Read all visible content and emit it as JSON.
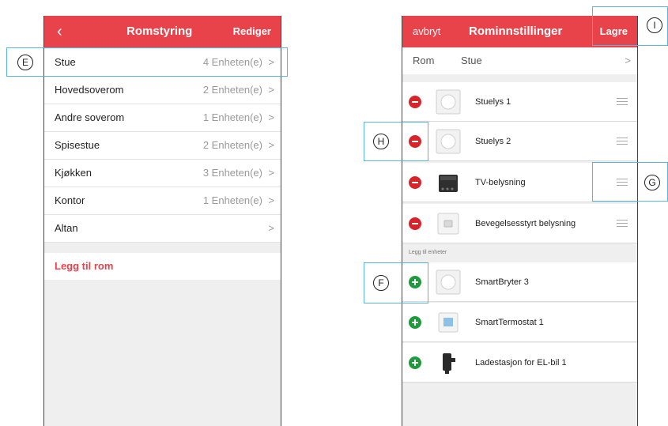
{
  "left_screen": {
    "back_icon": "‹",
    "title": "Romstyring",
    "edit_label": "Rediger",
    "rooms": [
      {
        "name": "Stue",
        "count": "4 Enheten(e)"
      },
      {
        "name": "Hovedsoverom",
        "count": "2 Enheten(e)"
      },
      {
        "name": "Andre soverom",
        "count": "1 Enheten(e)"
      },
      {
        "name": "Spisestue",
        "count": "2 Enheten(e)"
      },
      {
        "name": "Kjøkken",
        "count": "3 Enheten(e)"
      },
      {
        "name": "Kontor",
        "count": "1 Enheten(e)"
      },
      {
        "name": "Altan",
        "count": ""
      }
    ],
    "add_room_label": "Legg til rom",
    "accent_color": "#e8424a"
  },
  "right_screen": {
    "cancel_label": "avbryt",
    "title": "Rominnstillinger",
    "save_label": "Lagre",
    "room_label": "Rom",
    "room_value": "Stue",
    "room_devices": [
      {
        "name": "Stuelys 1",
        "icon": "dimmer-icon"
      },
      {
        "name": "Stuelys 2",
        "icon": "dimmer-icon"
      },
      {
        "name": "TV-belysning",
        "icon": "relay-module-icon"
      },
      {
        "name": "Bevegelsesstyrt belysning",
        "icon": "motion-sensor-icon"
      }
    ],
    "add_section_label": "Legg til enheter",
    "available_devices": [
      {
        "name": "SmartBryter 3",
        "icon": "dimmer-icon"
      },
      {
        "name": "SmartTermostat 1",
        "icon": "thermostat-icon"
      },
      {
        "name": "Ladestasjon for EL-bil 1",
        "icon": "ev-charger-icon"
      }
    ]
  },
  "callouts": {
    "E": "E",
    "F": "F",
    "G": "G",
    "H": "H",
    "I": "I"
  },
  "colors": {
    "remove": "#d8232a",
    "add": "#1f9a3c",
    "callout_border": "#5ab4e0"
  }
}
